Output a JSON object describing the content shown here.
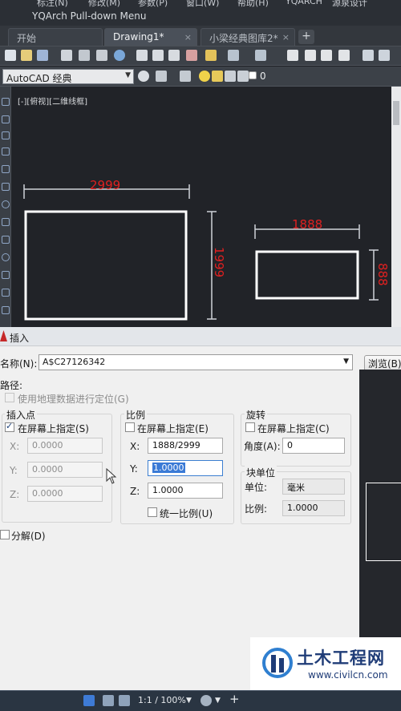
{
  "app": {
    "menu_items": [
      "标注(N)",
      "修改(M)",
      "参数(P)",
      "窗口(W)",
      "帮助(H)",
      "YQARCH",
      "源泉设计"
    ],
    "submenu_title": "YQArch Pull-down Menu"
  },
  "tabs": [
    {
      "label": "开始"
    },
    {
      "label": "Drawing1*",
      "close": "×"
    },
    {
      "label": "小梁经典图库2*",
      "close": "×"
    }
  ],
  "tab_add": "+",
  "workspace": {
    "value": "AutoCAD 经典",
    "arrow": "▼",
    "layer_value": "0"
  },
  "viewport": {
    "label": "[-][俯视][二维线框]"
  },
  "drawing": {
    "dims": {
      "a_width": "2999",
      "a_height": "1999",
      "b_width": "1888",
      "b_height": "888"
    },
    "dim_color": "#e02020",
    "line_color": "#ffffff"
  },
  "dialog": {
    "title": "插入",
    "name_label": "名称(N):",
    "name_value": "A$C27126342",
    "browse_label": "浏览(B)",
    "path_label": "路径:",
    "geo_label": "使用地理数据进行定位(G)",
    "insert_point": {
      "title": "插入点",
      "on_screen": "在屏幕上指定(S)",
      "x_label": "X:",
      "x_value": "0.0000",
      "y_label": "Y:",
      "y_value": "0.0000",
      "z_label": "Z:",
      "z_value": "0.0000"
    },
    "scale": {
      "title": "比例",
      "on_screen": "在屏幕上指定(E)",
      "x_label": "X:",
      "x_value": "1888/2999",
      "y_label": "Y:",
      "y_value": "1.0000",
      "z_label": "Z:",
      "z_value": "1.0000",
      "uniform": "统一比例(U)"
    },
    "rotation": {
      "title": "旋转",
      "on_screen": "在屏幕上指定(C)",
      "angle_label": "角度(A):",
      "angle_value": "0"
    },
    "block_unit": {
      "title": "块单位",
      "unit_label": "单位:",
      "unit_value": "毫米",
      "factor_label": "比例:",
      "factor_value": "1.0000"
    },
    "explode_label": "分解(D)"
  },
  "statusbar": {
    "scale": "1:1 / 100%"
  },
  "watermark": {
    "title": "土木工程网",
    "url": "www.civilcn.com"
  },
  "colors": {
    "accent_selection": "#3a7ad6",
    "cad_bg": "#212328",
    "dialog_bg": "#f0f0f0"
  }
}
